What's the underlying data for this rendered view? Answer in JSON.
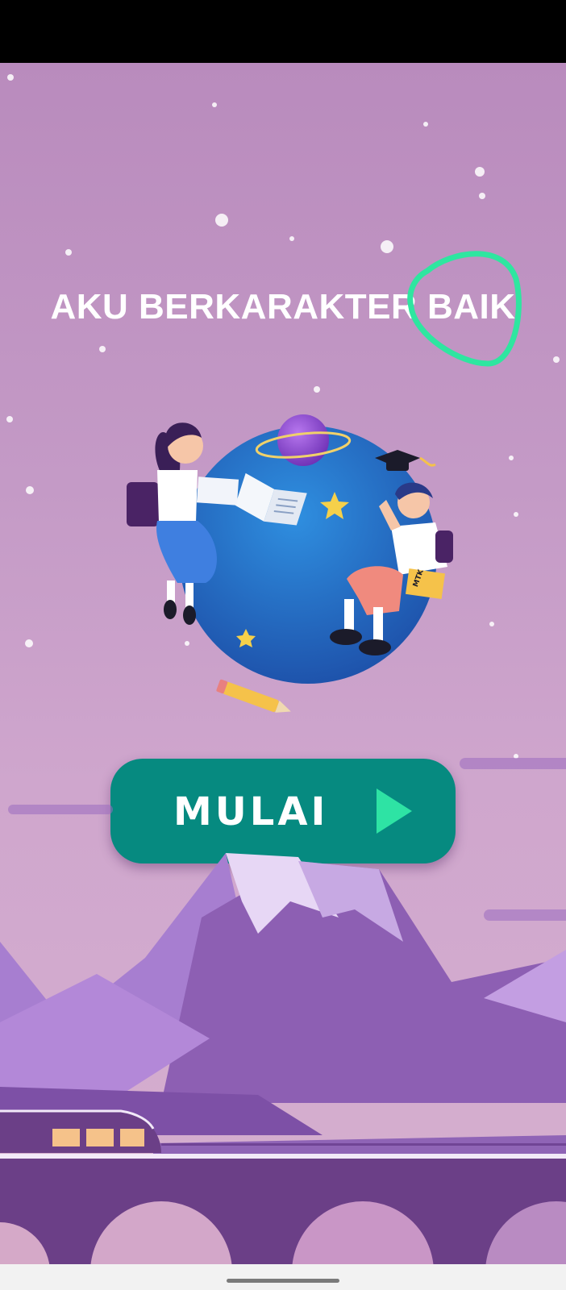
{
  "screen": {
    "title": "AKU BERKARAKTER BAIK",
    "start_button": {
      "label": "MULAI",
      "icon": "play-icon"
    },
    "illustration": {
      "book_label": "MTK"
    }
  },
  "colors": {
    "background": "#c49ac6",
    "button": "#068a80",
    "play_icon": "#2ee3a4",
    "highlight_circle": "#2ee6a0",
    "bridge": "#6b3f87"
  }
}
